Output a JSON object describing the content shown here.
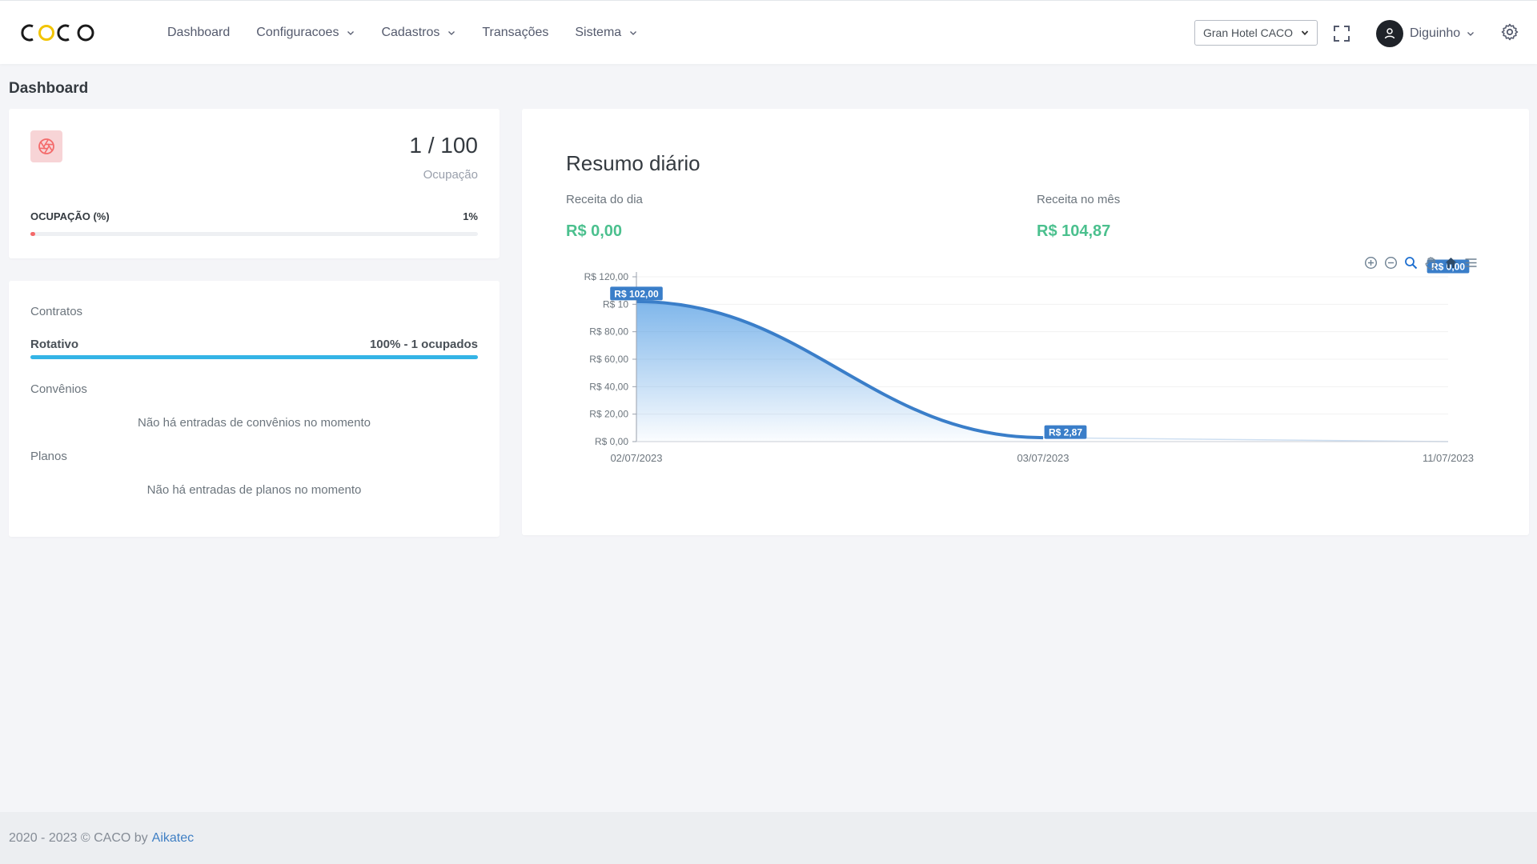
{
  "app": {
    "brand": "CACO"
  },
  "nav": {
    "items": [
      {
        "label": "Dashboard",
        "dropdown": false
      },
      {
        "label": "Configuracoes",
        "dropdown": true
      },
      {
        "label": "Cadastros",
        "dropdown": true
      },
      {
        "label": "Transações",
        "dropdown": false
      },
      {
        "label": "Sistema",
        "dropdown": true
      }
    ]
  },
  "header": {
    "hotel_selected": "Gran Hotel CACO",
    "user_name": "Diguinho"
  },
  "page": {
    "title": "Dashboard"
  },
  "occupancy": {
    "value": "1 / 100",
    "caption": "Ocupação",
    "bar_label": "OCUPAÇÃO (%)",
    "bar_value_text": "1%",
    "bar_fraction": 0.01,
    "bar_color": "#f46a6a"
  },
  "contracts": {
    "title": "Contratos",
    "rotativo": {
      "label": "Rotativo",
      "value_text": "100% - 1 ocupados",
      "fraction": 1.0,
      "color": "#34b4e6"
    },
    "convenios_title": "Convênios",
    "convenios_empty": "Não há entradas de convênios no momento",
    "planos_title": "Planos",
    "planos_empty": "Não há entradas de planos no momento"
  },
  "summary": {
    "title": "Resumo diário",
    "receita_dia_label": "Receita do dia",
    "receita_dia_value": "R$ 0,00",
    "receita_mes_label": "Receita no mês",
    "receita_mes_value": "R$ 104,87",
    "accent_color": "#4bc08e"
  },
  "chart_data": {
    "type": "area",
    "x": [
      "02/07/2023",
      "03/07/2023",
      "11/07/2023"
    ],
    "values": [
      102.0,
      2.87,
      0.0
    ],
    "data_labels": [
      "R$ 102,00",
      "R$ 2,87",
      "R$ 0,00"
    ],
    "y_ticks": [
      "R$ 0,00",
      "R$ 20,00",
      "R$ 40,00",
      "R$ 60,00",
      "R$ 80,00",
      "R$ 10",
      "R$ 120,00"
    ],
    "ylim": [
      0,
      120
    ],
    "grid": true,
    "line_color": "#3a7ec9",
    "toolbar": [
      "zoom-in-icon",
      "zoom-out-icon",
      "selection-zoom-icon",
      "pan-hand-icon",
      "reset-home-icon",
      "menu-icon"
    ]
  },
  "footer": {
    "text": "2020 - 2023 © CACO by",
    "link": "Aikatec"
  }
}
